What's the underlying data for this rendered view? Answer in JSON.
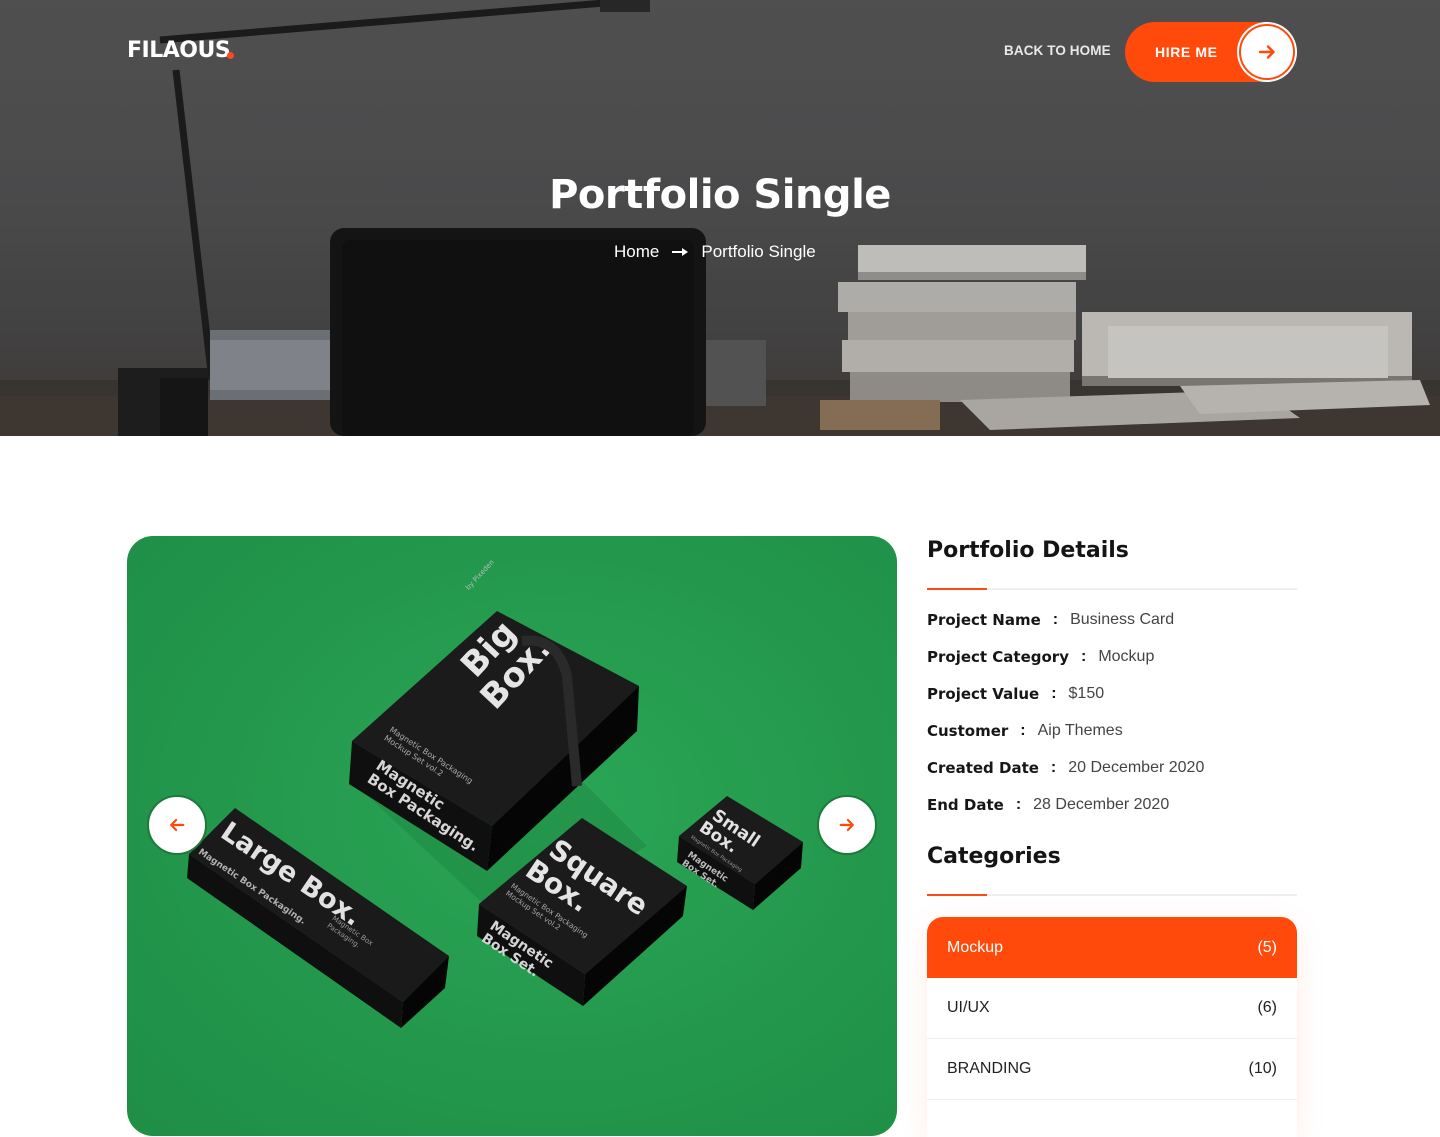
{
  "header": {
    "logo": "FILAOUS",
    "back_home": "BACK TO HOME",
    "hire_label": "HIRE ME"
  },
  "hero": {
    "title": "Portfolio Single",
    "breadcrumb_home": "Home",
    "breadcrumb_current": "Portfolio Single"
  },
  "slider": {
    "boxes": {
      "big_1": "Big",
      "big_2": "Box.",
      "big_sub_1": "Magnetic Box Packaging",
      "big_sub_2": "Mockup Set vol.2",
      "big_side_1": "Magnetic",
      "big_side_2": "Box Packaging.",
      "big_brand": "by Pixeden",
      "large": "Large Box.",
      "large_sub": "Magnetic Box Packaging.",
      "large_side_1": "Magnetic Box",
      "large_side_2": "Packaging.",
      "square_1": "Square",
      "square_2": "Box.",
      "square_sub_1": "Magnetic Box Packaging",
      "square_sub_2": "Mockup Set vol.2",
      "square_side_1": "Magnetic",
      "square_side_2": "Box Set.",
      "small_1": "Small",
      "small_2": "Box.",
      "small_sub": "Magnetic Box Packaging",
      "small_side_1": "Magnetic",
      "small_side_2": "Box Set."
    }
  },
  "details": {
    "heading": "Portfolio Details",
    "rows": [
      {
        "key": "Project Name",
        "value": "Business Card"
      },
      {
        "key": "Project Category",
        "value": "Mockup"
      },
      {
        "key": "Project Value",
        "value": "$150"
      },
      {
        "key": "Customer",
        "value": "Aip Themes"
      },
      {
        "key": "Created Date",
        "value": "20 December 2020"
      },
      {
        "key": "End Date",
        "value": "28 December 2020"
      }
    ],
    "separator": ":"
  },
  "categories": {
    "heading": "Categories",
    "items": [
      {
        "name": "Mockup",
        "count": "(5)"
      },
      {
        "name": "UI/UX",
        "count": "(6)"
      },
      {
        "name": "BRANDING",
        "count": "(10)"
      }
    ]
  },
  "colors": {
    "accent": "#ff4a0c",
    "slider_bg": "#23984c",
    "text_dark": "#141414"
  }
}
